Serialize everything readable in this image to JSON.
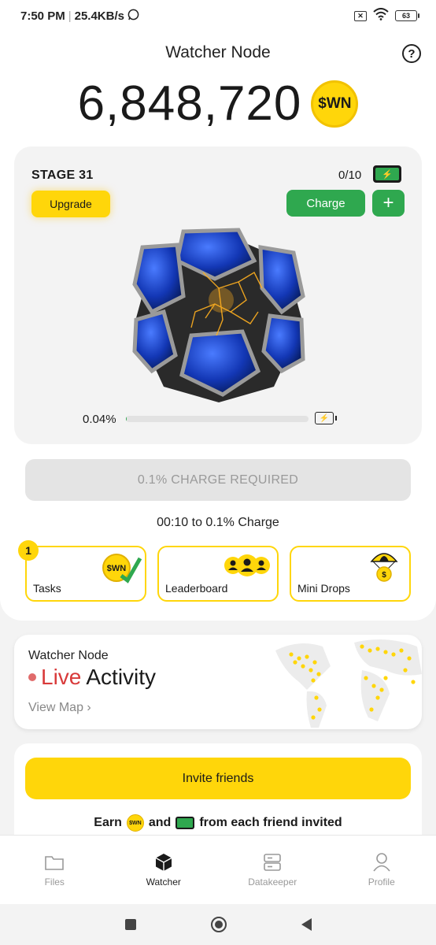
{
  "status_bar": {
    "time": "7:50 PM",
    "net_speed": "25.4KB/s",
    "battery": "63"
  },
  "header": {
    "title": "Watcher Node",
    "help_icon": "question-circle-icon"
  },
  "balance": {
    "amount": "6,848,720",
    "token_symbol": "$WN"
  },
  "stage_card": {
    "stage_label": "STAGE 31",
    "upgrade_label": "Upgrade",
    "charge_count": "0/10",
    "charge_label": "Charge",
    "add_label": "+",
    "progress_text": "0.04%",
    "progress_value": 0.04
  },
  "charge_required_label": "0.1% CHARGE REQUIRED",
  "timer_text": "00:10 to 0.1% Charge",
  "tiles": [
    {
      "label": "Tasks",
      "badge": "1",
      "icon": "wn-coin-check-icon"
    },
    {
      "label": "Leaderboard",
      "icon": "users-group-icon"
    },
    {
      "label": "Mini Drops",
      "icon": "parachute-coin-icon"
    }
  ],
  "live_activity": {
    "subtitle": "Watcher Node",
    "live_word": "Live",
    "activity_word": "Activity",
    "view_map": "View Map",
    "chevron": "›"
  },
  "invite": {
    "button_label": "Invite friends",
    "earn_prefix": "Earn",
    "earn_and": "and",
    "earn_suffix": "from each friend invited",
    "coin_text": "$WN"
  },
  "bottom_nav": [
    {
      "label": "Files",
      "icon": "folder-icon",
      "active": false
    },
    {
      "label": "Watcher",
      "icon": "cube-icon",
      "active": true
    },
    {
      "label": "Datakeeper",
      "icon": "server-icon",
      "active": false
    },
    {
      "label": "Profile",
      "icon": "user-icon",
      "active": false
    }
  ],
  "colors": {
    "accent_yellow": "#ffd60a",
    "accent_green": "#2fa84f",
    "live_red": "#d83a3a"
  }
}
